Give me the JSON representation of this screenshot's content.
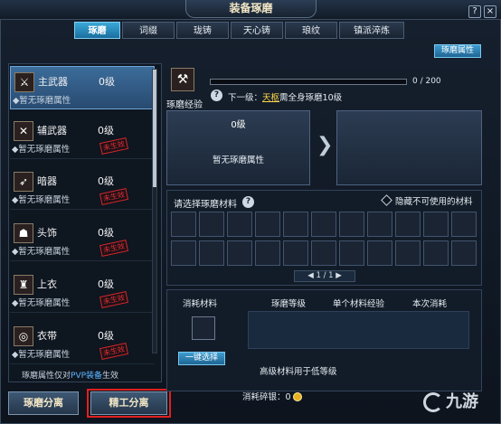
{
  "window": {
    "title": "装备琢磨",
    "help_label": "?",
    "close_label": "×"
  },
  "tabs": [
    {
      "label": "琢磨",
      "active": true
    },
    {
      "label": "词缀",
      "active": false
    },
    {
      "label": "珑铸",
      "active": false
    },
    {
      "label": "天心铸",
      "active": false
    },
    {
      "label": "琅纹",
      "active": false
    },
    {
      "label": "镇派淬炼",
      "active": false
    }
  ],
  "attr_button_label": "琢磨属性",
  "equipment": [
    {
      "name": "主武器",
      "level": "0级",
      "status": "◆暂无琢磨属性",
      "stamp": "",
      "selected": true
    },
    {
      "name": "辅武器",
      "level": "0级",
      "status": "◆暂无琢磨属性",
      "stamp": "未生效",
      "selected": false
    },
    {
      "name": "暗器",
      "level": "0级",
      "status": "◆暂无琢磨属性",
      "stamp": "未生效",
      "selected": false
    },
    {
      "name": "头饰",
      "level": "0级",
      "status": "◆暂无琢磨属性",
      "stamp": "未生效",
      "selected": false
    },
    {
      "name": "上衣",
      "level": "0级",
      "status": "◆暂无琢磨属性",
      "stamp": "未生效",
      "selected": false
    },
    {
      "name": "衣带",
      "level": "0级",
      "status": "◆暂无琢磨属性",
      "stamp": "未生效",
      "selected": false
    }
  ],
  "pvp_note": {
    "prefix": "琢磨属性仅对",
    "highlight": "PVP装备",
    "suffix": "生效"
  },
  "bottom_buttons": {
    "left": "琢磨分离",
    "right": "精工分离"
  },
  "exp": {
    "label": "琢磨经验",
    "progress_text": "0 / 200",
    "progress": 0
  },
  "next_level": {
    "prefix": "下一级：",
    "highlight": "天枢",
    "suffix": "需全身琢磨10级"
  },
  "current_box": {
    "level": "0级",
    "attr": "暂无琢磨属性"
  },
  "next_box": {
    "level": "",
    "attr": ""
  },
  "materials": {
    "title": "请选择琢磨材料",
    "hide_label": "隐藏不可使用的材料",
    "pager": "◀ 1 / 1 ▶",
    "slots": 22
  },
  "consume": {
    "headers": [
      "消耗材料",
      "琢磨等级",
      "单个材料经验",
      "本次消耗"
    ],
    "one_key_label": "一键选择",
    "high_note": "高级材料用于低等级",
    "fragments_label": "消耗碎银：",
    "fragments_value": "0"
  },
  "watermark": {
    "text": "九游"
  }
}
